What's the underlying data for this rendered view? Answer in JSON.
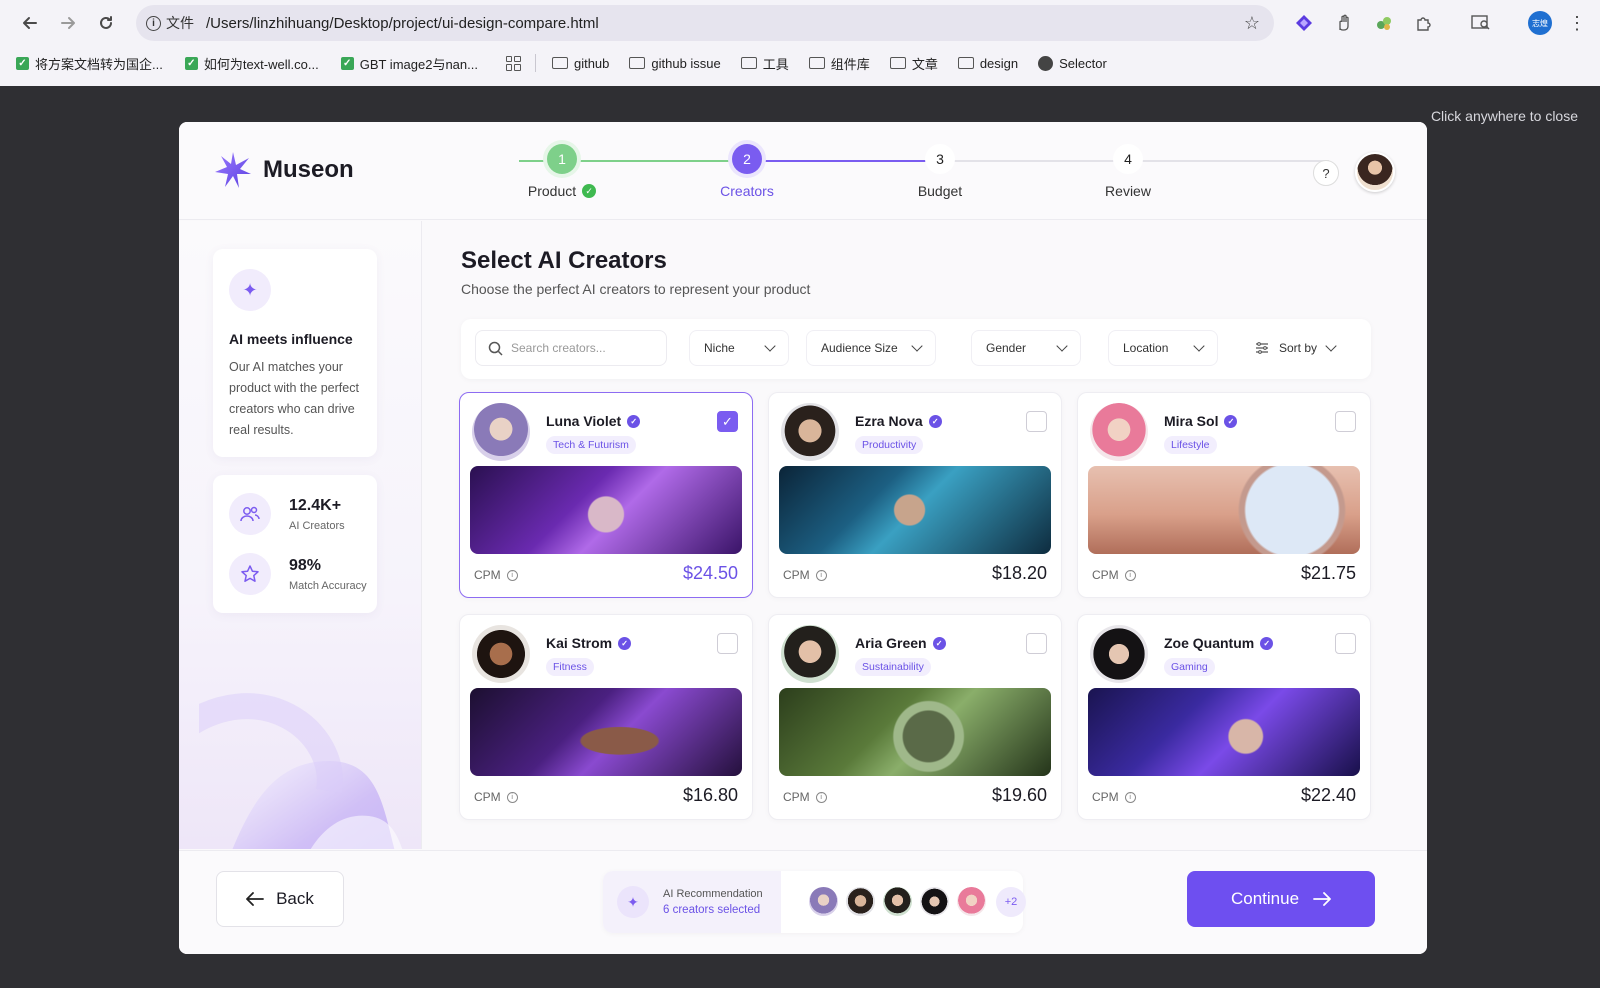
{
  "browser": {
    "omnibox_label": "文件",
    "url": "/Users/linzhihuang/Desktop/project/ui-design-compare.html",
    "bookmarks": [
      {
        "label": "将方案文档转为国企...",
        "kind": "check"
      },
      {
        "label": "如何为text-well.co...",
        "kind": "check"
      },
      {
        "label": "GBT image2与nan...",
        "kind": "check"
      },
      {
        "label": "github",
        "kind": "folder"
      },
      {
        "label": "github issue",
        "kind": "folder"
      },
      {
        "label": "工具",
        "kind": "folder"
      },
      {
        "label": "组件库",
        "kind": "folder"
      },
      {
        "label": "文章",
        "kind": "folder"
      },
      {
        "label": "design",
        "kind": "folder"
      },
      {
        "label": "Selector",
        "kind": "globe"
      }
    ],
    "avatar_text": "志煌"
  },
  "overlay": {
    "close_hint": "Click anywhere to close"
  },
  "header": {
    "brand": "Museon",
    "steps": [
      {
        "num": "1",
        "label": "Product",
        "state": "done"
      },
      {
        "num": "2",
        "label": "Creators",
        "state": "active"
      },
      {
        "num": "3",
        "label": "Budget",
        "state": "todo"
      },
      {
        "num": "4",
        "label": "Review",
        "state": "todo"
      }
    ],
    "help": "?"
  },
  "sidebar": {
    "info_title": "AI meets influence",
    "info_desc": "Our AI matches your product with the perfect creators who can drive real results.",
    "stats": [
      {
        "value": "12.4K+",
        "label": "AI Creators",
        "icon": "users-icon"
      },
      {
        "value": "98%",
        "label": "Match Accuracy",
        "icon": "star-icon"
      }
    ]
  },
  "main": {
    "title": "Select AI Creators",
    "subtitle": "Choose the perfect AI creators to represent your product",
    "search_placeholder": "Search creators...",
    "filters": [
      "Niche",
      "Audience Size",
      "Gender",
      "Location"
    ],
    "sort_label": "Sort by"
  },
  "creators": [
    {
      "name": "Luna Violet",
      "tag": "Tech & Futurism",
      "cpm_label": "CPM",
      "price": "$24.50",
      "selected": true
    },
    {
      "name": "Ezra Nova",
      "tag": "Productivity",
      "cpm_label": "CPM",
      "price": "$18.20",
      "selected": false
    },
    {
      "name": "Mira Sol",
      "tag": "Lifestyle",
      "cpm_label": "CPM",
      "price": "$21.75",
      "selected": false
    },
    {
      "name": "Kai Strom",
      "tag": "Fitness",
      "cpm_label": "CPM",
      "price": "$16.80",
      "selected": false
    },
    {
      "name": "Aria Green",
      "tag": "Sustainability",
      "cpm_label": "CPM",
      "price": "$19.60",
      "selected": false
    },
    {
      "name": "Zoe Quantum",
      "tag": "Gaming",
      "cpm_label": "CPM",
      "price": "$22.40",
      "selected": false
    }
  ],
  "footer": {
    "back": "Back",
    "reco_title": "AI Recommendation",
    "reco_count": "6 creators selected",
    "more": "+2",
    "continue": "Continue"
  },
  "colors": {
    "accent": "#6e4ff0",
    "success": "#5cc46b"
  }
}
